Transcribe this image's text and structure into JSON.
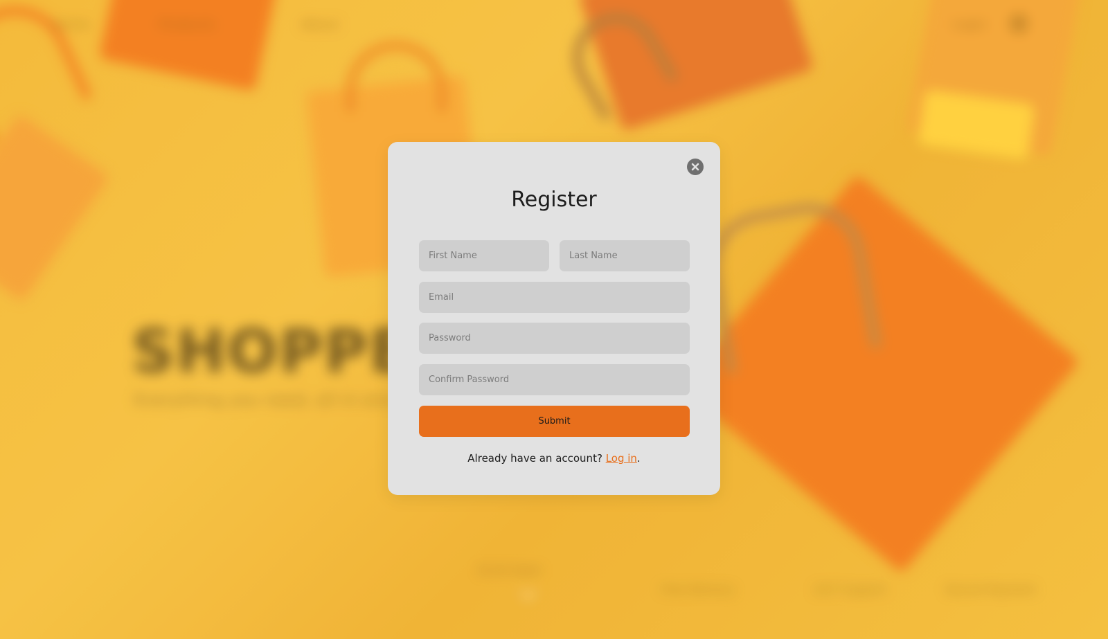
{
  "background": {
    "nav_links": [
      "Home",
      "Products",
      "About"
    ],
    "nav_right": "Login",
    "brand_title": "SHOPPER",
    "brand_tagline": "Everything you need, all in one place",
    "footer_cta": "Scroll down",
    "footer_items": [
      "Free Delivery",
      "24/7 Support",
      "Secure Payment"
    ],
    "colors": {
      "backdrop": "#f4b93a",
      "bag_orange": "#f27a1f",
      "bag_light": "#f6a23a",
      "bag_yellow": "#ffd23f"
    }
  },
  "modal": {
    "title": "Register",
    "close_icon": "close-icon",
    "fields": {
      "first_name": {
        "placeholder": "First Name",
        "value": ""
      },
      "last_name": {
        "placeholder": "Last Name",
        "value": ""
      },
      "email": {
        "placeholder": "Email",
        "value": ""
      },
      "password": {
        "placeholder": "Password",
        "value": ""
      },
      "confirm_password": {
        "placeholder": "Confirm Password",
        "value": ""
      }
    },
    "submit_label": "Submit",
    "login_prompt": "Already have an account?",
    "login_link": "Log in",
    "login_suffix": ".",
    "colors": {
      "panel": "#e2e2e2",
      "field": "#cfcfcf",
      "accent": "#e86f1c"
    }
  }
}
